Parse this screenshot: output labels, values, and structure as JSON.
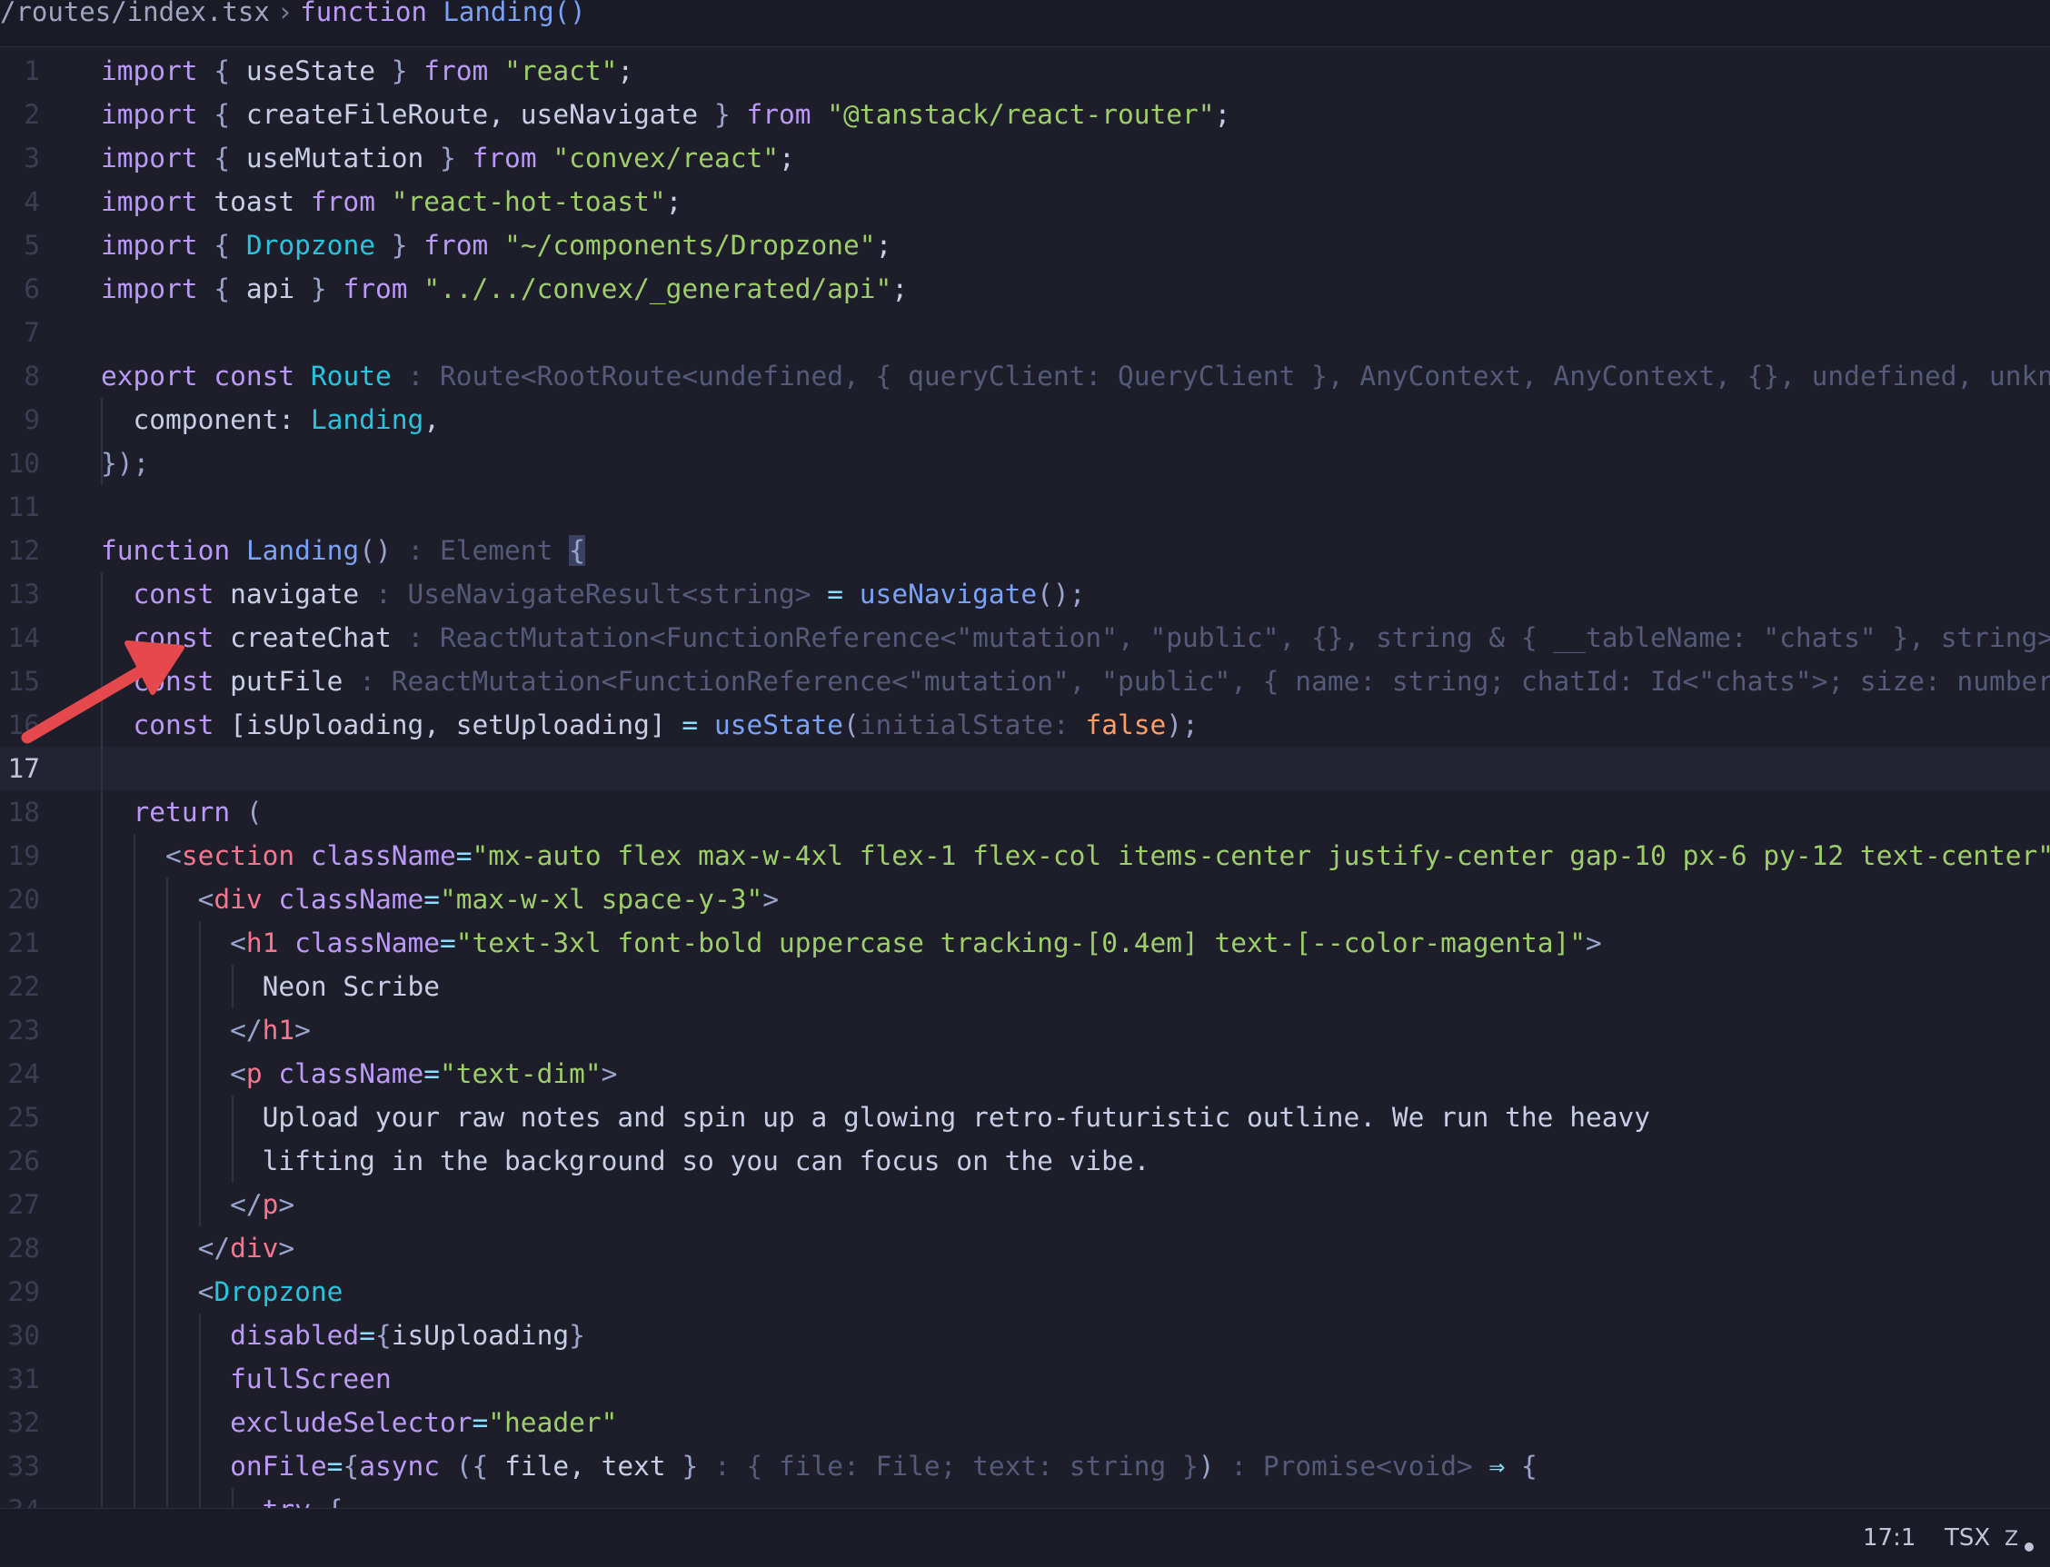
{
  "breadcrumb": {
    "path": "/routes/index.tsx",
    "separator": "›",
    "keyword": "function",
    "symbol": "Landing()"
  },
  "editor": {
    "cursor_line": 17,
    "lines": [
      {
        "n": "1",
        "tokens": [
          [
            "kw",
            "import"
          ],
          [
            "txt",
            " "
          ],
          [
            "pun",
            "{"
          ],
          [
            "txt",
            " useState "
          ],
          [
            "pun",
            "}"
          ],
          [
            "txt",
            " "
          ],
          [
            "kw",
            "from"
          ],
          [
            "txt",
            " "
          ],
          [
            "str",
            "\"react\""
          ],
          [
            "txt",
            ";"
          ]
        ]
      },
      {
        "n": "2",
        "tokens": [
          [
            "kw",
            "import"
          ],
          [
            "txt",
            " "
          ],
          [
            "pun",
            "{"
          ],
          [
            "txt",
            " createFileRoute, useNavigate "
          ],
          [
            "pun",
            "}"
          ],
          [
            "txt",
            " "
          ],
          [
            "kw",
            "from"
          ],
          [
            "txt",
            " "
          ],
          [
            "str",
            "\"@tanstack/react-router\""
          ],
          [
            "txt",
            ";"
          ]
        ]
      },
      {
        "n": "3",
        "tokens": [
          [
            "kw",
            "import"
          ],
          [
            "txt",
            " "
          ],
          [
            "pun",
            "{"
          ],
          [
            "txt",
            " useMutation "
          ],
          [
            "pun",
            "}"
          ],
          [
            "txt",
            " "
          ],
          [
            "kw",
            "from"
          ],
          [
            "txt",
            " "
          ],
          [
            "str",
            "\"convex/react\""
          ],
          [
            "txt",
            ";"
          ]
        ]
      },
      {
        "n": "4",
        "tokens": [
          [
            "kw",
            "import"
          ],
          [
            "txt",
            " toast "
          ],
          [
            "kw",
            "from"
          ],
          [
            "txt",
            " "
          ],
          [
            "str",
            "\"react-hot-toast\""
          ],
          [
            "txt",
            ";"
          ]
        ]
      },
      {
        "n": "5",
        "tokens": [
          [
            "kw",
            "import"
          ],
          [
            "txt",
            " "
          ],
          [
            "pun",
            "{"
          ],
          [
            "txt",
            " "
          ],
          [
            "cls",
            "Dropzone"
          ],
          [
            "txt",
            " "
          ],
          [
            "pun",
            "}"
          ],
          [
            "txt",
            " "
          ],
          [
            "kw",
            "from"
          ],
          [
            "txt",
            " "
          ],
          [
            "str",
            "\"~/components/Dropzone\""
          ],
          [
            "txt",
            ";"
          ]
        ]
      },
      {
        "n": "6",
        "tokens": [
          [
            "kw",
            "import"
          ],
          [
            "txt",
            " "
          ],
          [
            "pun",
            "{"
          ],
          [
            "txt",
            " api "
          ],
          [
            "pun",
            "}"
          ],
          [
            "txt",
            " "
          ],
          [
            "kw",
            "from"
          ],
          [
            "txt",
            " "
          ],
          [
            "str",
            "\"../../convex/_generated/api\""
          ],
          [
            "txt",
            ";"
          ]
        ]
      },
      {
        "n": "7",
        "tokens": []
      },
      {
        "n": "8",
        "tokens": [
          [
            "kw",
            "export"
          ],
          [
            "txt",
            " "
          ],
          [
            "kw",
            "const"
          ],
          [
            "txt",
            " "
          ],
          [
            "cls",
            "Route"
          ],
          [
            "hint",
            " : Route<RootRoute<undefined, { queryClient: QueryClient }, AnyContext, AnyContext, {}, undefined, unknown>>"
          ]
        ]
      },
      {
        "n": "9",
        "tokens": [
          [
            "txt",
            "  component: "
          ],
          [
            "cls",
            "Landing"
          ],
          [
            "txt",
            ","
          ]
        ]
      },
      {
        "n": "10",
        "tokens": [
          [
            "pun",
            "});"
          ]
        ]
      },
      {
        "n": "11",
        "tokens": []
      },
      {
        "n": "12",
        "tokens": [
          [
            "kw",
            "function"
          ],
          [
            "txt",
            " "
          ],
          [
            "fn",
            "Landing"
          ],
          [
            "pun",
            "()"
          ],
          [
            "hint",
            " : Element "
          ],
          [
            "cursor",
            "{"
          ]
        ]
      },
      {
        "n": "13",
        "tokens": [
          [
            "txt",
            "  "
          ],
          [
            "kw",
            "const"
          ],
          [
            "txt",
            " navigate"
          ],
          [
            "hint",
            " : UseNavigateResult<string>"
          ],
          [
            "txt",
            " "
          ],
          [
            "op",
            "="
          ],
          [
            "txt",
            " "
          ],
          [
            "fn",
            "useNavigate"
          ],
          [
            "pun",
            "();"
          ]
        ]
      },
      {
        "n": "14",
        "tokens": [
          [
            "txt",
            "  "
          ],
          [
            "kw",
            "const"
          ],
          [
            "txt",
            " createChat"
          ],
          [
            "hint",
            " : ReactMutation<FunctionReference<\"mutation\", \"public\", {}, string & { __tableName: \"chats\" }, string>>"
          ]
        ]
      },
      {
        "n": "15",
        "tokens": [
          [
            "txt",
            "  "
          ],
          [
            "kw",
            "const"
          ],
          [
            "txt",
            " putFile"
          ],
          [
            "hint",
            " : ReactMutation<FunctionReference<\"mutation\", \"public\", { name: string; chatId: Id<\"chats\">; size: number }>>"
          ]
        ]
      },
      {
        "n": "16",
        "tokens": [
          [
            "txt",
            "  "
          ],
          [
            "kw",
            "const"
          ],
          [
            "txt",
            " [isUploading, setUploading] "
          ],
          [
            "op",
            "="
          ],
          [
            "txt",
            " "
          ],
          [
            "fn",
            "useState"
          ],
          [
            "pun",
            "("
          ],
          [
            "hint",
            "initialState: "
          ],
          [
            "bool",
            "false"
          ],
          [
            "pun",
            ");"
          ]
        ]
      },
      {
        "n": "17",
        "tokens": []
      },
      {
        "n": "18",
        "tokens": [
          [
            "txt",
            "  "
          ],
          [
            "kw",
            "return"
          ],
          [
            "txt",
            " "
          ],
          [
            "pun",
            "("
          ]
        ]
      },
      {
        "n": "19",
        "tokens": [
          [
            "txt",
            "    "
          ],
          [
            "pun",
            "<"
          ],
          [
            "tag",
            "section"
          ],
          [
            "txt",
            " "
          ],
          [
            "attr",
            "className"
          ],
          [
            "op",
            "="
          ],
          [
            "str",
            "\"mx-auto flex max-w-4xl flex-1 flex-col items-center justify-center gap-10 px-6 py-12 text-center\""
          ],
          [
            "pun",
            ">"
          ]
        ]
      },
      {
        "n": "20",
        "tokens": [
          [
            "txt",
            "      "
          ],
          [
            "pun",
            "<"
          ],
          [
            "tag",
            "div"
          ],
          [
            "txt",
            " "
          ],
          [
            "attr",
            "className"
          ],
          [
            "op",
            "="
          ],
          [
            "str",
            "\"max-w-xl space-y-3\""
          ],
          [
            "pun",
            ">"
          ]
        ]
      },
      {
        "n": "21",
        "tokens": [
          [
            "txt",
            "        "
          ],
          [
            "pun",
            "<"
          ],
          [
            "tag",
            "h1"
          ],
          [
            "txt",
            " "
          ],
          [
            "attr",
            "className"
          ],
          [
            "op",
            "="
          ],
          [
            "str",
            "\"text-3xl font-bold uppercase tracking-[0.4em] text-[--color-magenta]\""
          ],
          [
            "pun",
            ">"
          ]
        ]
      },
      {
        "n": "22",
        "tokens": [
          [
            "txt",
            "          Neon Scribe"
          ]
        ]
      },
      {
        "n": "23",
        "tokens": [
          [
            "txt",
            "        "
          ],
          [
            "pun",
            "</"
          ],
          [
            "tag",
            "h1"
          ],
          [
            "pun",
            ">"
          ]
        ]
      },
      {
        "n": "24",
        "tokens": [
          [
            "txt",
            "        "
          ],
          [
            "pun",
            "<"
          ],
          [
            "tag",
            "p"
          ],
          [
            "txt",
            " "
          ],
          [
            "attr",
            "className"
          ],
          [
            "op",
            "="
          ],
          [
            "str",
            "\"text-dim\""
          ],
          [
            "pun",
            ">"
          ]
        ]
      },
      {
        "n": "25",
        "tokens": [
          [
            "txt",
            "          Upload your raw notes and spin up a glowing retro-futuristic outline. We run the heavy"
          ]
        ]
      },
      {
        "n": "26",
        "tokens": [
          [
            "txt",
            "          lifting in the background so you can focus on the vibe."
          ]
        ]
      },
      {
        "n": "27",
        "tokens": [
          [
            "txt",
            "        "
          ],
          [
            "pun",
            "</"
          ],
          [
            "tag",
            "p"
          ],
          [
            "pun",
            ">"
          ]
        ]
      },
      {
        "n": "28",
        "tokens": [
          [
            "txt",
            "      "
          ],
          [
            "pun",
            "</"
          ],
          [
            "tag",
            "div"
          ],
          [
            "pun",
            ">"
          ]
        ]
      },
      {
        "n": "29",
        "tokens": [
          [
            "txt",
            "      "
          ],
          [
            "pun",
            "<"
          ],
          [
            "cls",
            "Dropzone"
          ]
        ]
      },
      {
        "n": "30",
        "tokens": [
          [
            "txt",
            "        "
          ],
          [
            "attr",
            "disabled"
          ],
          [
            "op",
            "="
          ],
          [
            "pun",
            "{"
          ],
          [
            "txt",
            "isUploading"
          ],
          [
            "pun",
            "}"
          ]
        ]
      },
      {
        "n": "31",
        "tokens": [
          [
            "txt",
            "        "
          ],
          [
            "attr",
            "fullScreen"
          ]
        ]
      },
      {
        "n": "32",
        "tokens": [
          [
            "txt",
            "        "
          ],
          [
            "attr",
            "excludeSelector"
          ],
          [
            "op",
            "="
          ],
          [
            "str",
            "\"header\""
          ]
        ]
      },
      {
        "n": "33",
        "tokens": [
          [
            "txt",
            "        "
          ],
          [
            "attr",
            "onFile"
          ],
          [
            "op",
            "="
          ],
          [
            "pun",
            "{"
          ],
          [
            "kw",
            "async"
          ],
          [
            "txt",
            " "
          ],
          [
            "pun",
            "({"
          ],
          [
            "txt",
            " file, text "
          ],
          [
            "pun",
            "}"
          ],
          [
            "hint",
            " : { file: File; text: string }"
          ],
          [
            "pun",
            ")"
          ],
          [
            "hint",
            " : Promise<void>"
          ],
          [
            "txt",
            " "
          ],
          [
            "op",
            "⇒"
          ],
          [
            "txt",
            " "
          ],
          [
            "pun",
            "{"
          ]
        ]
      },
      {
        "n": "34",
        "tokens": [
          [
            "txt",
            "          "
          ],
          [
            "kw",
            "try"
          ],
          [
            "txt",
            " "
          ],
          [
            "pun",
            "{"
          ]
        ]
      }
    ]
  },
  "statusbar": {
    "position": "17:1",
    "language": "TSX",
    "icon": "zed-assistant-icon"
  },
  "annotation": {
    "icon": "red-arrow-icon",
    "color": "#e5484d"
  }
}
